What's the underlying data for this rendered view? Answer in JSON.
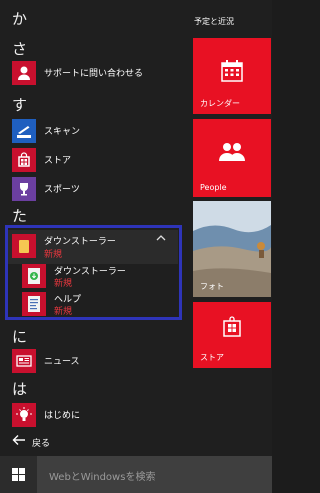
{
  "app_list": {
    "sections": [
      {
        "letter": "か"
      },
      {
        "letter": "さ"
      },
      {
        "letter": "す"
      },
      {
        "letter": "た"
      },
      {
        "letter": "に"
      },
      {
        "letter": "は"
      }
    ],
    "apps": [
      {
        "label": "サポートに問い合わせる",
        "icon": "person-support-icon"
      },
      {
        "label": "スキャン",
        "icon": "scanner-icon"
      },
      {
        "label": "ストア",
        "icon": "store-bag-icon"
      },
      {
        "label": "スポーツ",
        "icon": "trophy-icon"
      },
      {
        "label": "ニュース",
        "icon": "news-icon"
      },
      {
        "label": "はじめに",
        "icon": "lightbulb-icon"
      }
    ],
    "group": {
      "title": "ダウンストーラー",
      "badge": "新規",
      "items": [
        {
          "title": "ダウンストーラー",
          "badge": "新規",
          "icon": "downstaller-app-icon"
        },
        {
          "title": "ヘルプ",
          "badge": "新規",
          "icon": "help-document-icon"
        }
      ]
    },
    "back_label": "戻る"
  },
  "tiles": {
    "group_title": "予定と近況",
    "items": [
      {
        "label": "カレンダー",
        "icon": "calendar-icon"
      },
      {
        "label": "People",
        "icon": "people-icon"
      },
      {
        "label": "フォト",
        "icon": "photo-tile"
      },
      {
        "label": "ストア",
        "icon": "store-bag-icon"
      }
    ]
  },
  "taskbar": {
    "search_placeholder": "WebとWindowsを検索"
  },
  "colors": {
    "accent": "#e81123",
    "icon_red": "#c8102e",
    "icon_blue": "#1f5fbf",
    "icon_purple": "#6b3fa0",
    "highlight_border": "#2e34b9",
    "badge_red": "#e8373e",
    "background": "#1f1f1f"
  }
}
